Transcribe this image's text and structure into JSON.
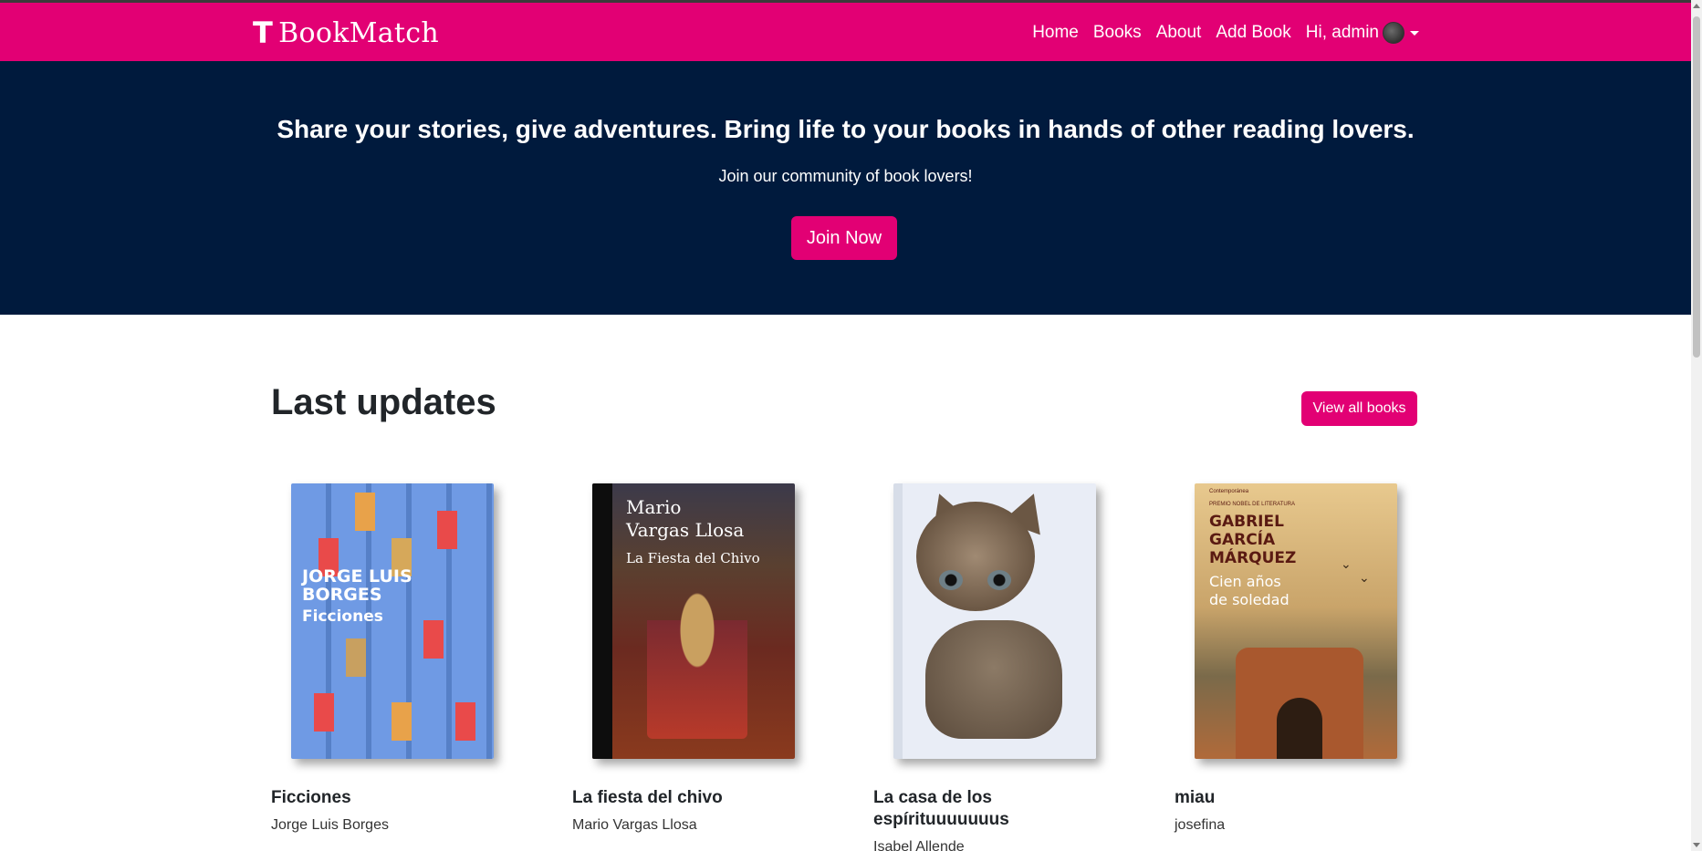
{
  "colors": {
    "brand": "#e20074",
    "hero_background": "#001a3d",
    "text": "#212529"
  },
  "navbar": {
    "logo_glyph": "T",
    "brand": "BookMatch",
    "links": [
      "Home",
      "Books",
      "About",
      "Add Book"
    ],
    "user_greeting": "Hi, admin",
    "avatar_icon": "user-avatar",
    "dropdown_icon": "chevron-down-icon"
  },
  "hero": {
    "title": "Share your stories, give adventures. Bring life to your books in hands of other reading lovers.",
    "subtitle": "Join our community of book lovers!",
    "cta": "Join Now"
  },
  "updates": {
    "heading": "Last updates",
    "view_all": "View all books",
    "books": [
      {
        "title": "Ficciones",
        "author": "Jorge Luis Borges",
        "cover": {
          "line1": "JORGE LUIS",
          "line2": "BORGES",
          "line3": "Ficciones"
        }
      },
      {
        "title": "La fiesta del chivo",
        "author": "Mario Vargas Llosa",
        "cover": {
          "line1": "Mario",
          "line2": "Vargas Llosa",
          "line3": "La Fiesta del Chivo"
        }
      },
      {
        "title": "La casa de los espírituuuuuuus",
        "author": "Isabel Allende",
        "cover": {
          "subject": "kitten photo"
        }
      },
      {
        "title": "miau",
        "author": "josefina",
        "cover": {
          "top1": "Contemporánea",
          "top2": "PREMIO NOBEL DE LITERATURA",
          "line1": "GABRIEL",
          "line2": "GARCÍA",
          "line3": "MÁRQUEZ",
          "line4": "Cien años",
          "line5": "de soledad"
        }
      }
    ]
  }
}
